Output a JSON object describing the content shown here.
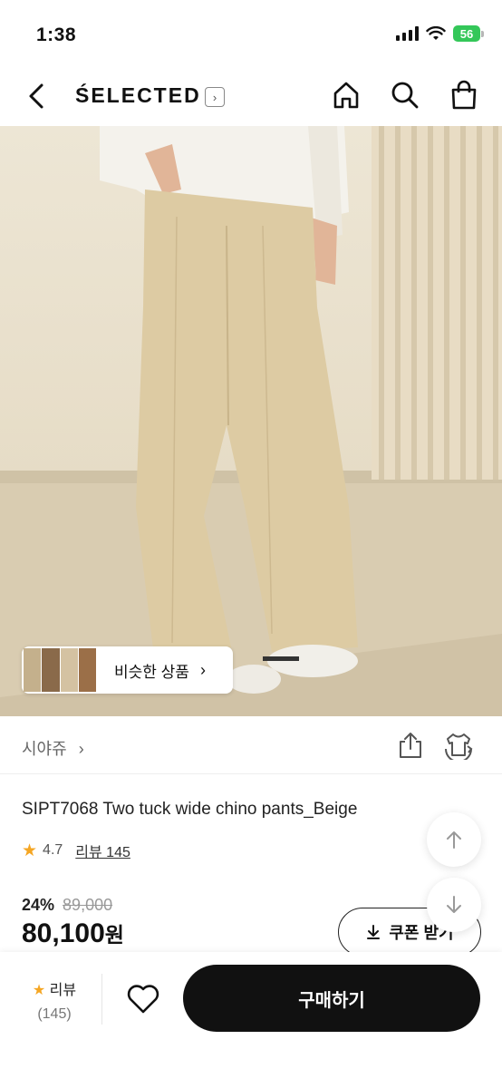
{
  "status_bar": {
    "time": "1:38",
    "battery": "56"
  },
  "nav": {
    "brand": "ŚELECTED",
    "brand_arrow": "›"
  },
  "hero": {
    "similar_label": "비슷한 상품",
    "similar_chevron": "›"
  },
  "store": {
    "name": "시야쥬",
    "chevron": "›"
  },
  "product": {
    "title": "SIPT7068 Two tuck wide chino pants_Beige",
    "rating": "4.7",
    "review_link": "리뷰 145",
    "discount_pct": "24%",
    "original_price": "89,000",
    "price": "80,100",
    "currency": "원"
  },
  "coupon": {
    "label": "쿠폰 받기"
  },
  "bottom_bar": {
    "review_label": "리뷰",
    "review_count": "(145)",
    "buy_label": "구매하기"
  },
  "colors": {
    "accent_star": "#f5a623",
    "buy_button": "#111111"
  }
}
